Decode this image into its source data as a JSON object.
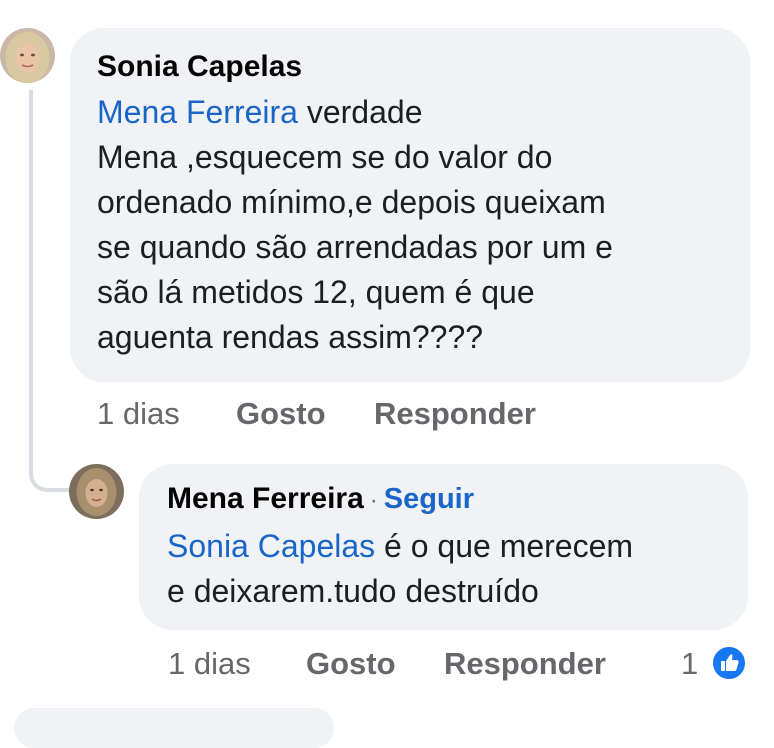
{
  "comment1": {
    "author": "Sonia Capelas",
    "mention": "Mena Ferreira",
    "first_line_rest": " verdade",
    "lines": [
      "Mena ,esquecem se do valor do",
      "ordenado mínimo,e depois queixam",
      "se quando são arrendadas por um e",
      "são lá metidos 12, quem é que",
      "aguenta rendas assim????"
    ],
    "time": "1 dias",
    "like_label": "Gosto",
    "reply_label": "Responder"
  },
  "reply1": {
    "author": "Mena Ferreira",
    "separator": "·",
    "follow_label": "Seguir",
    "mention": "Sonia Capelas",
    "first_line_rest": " é  o que merecem",
    "lines": [
      "e deixarem.tudo destruído"
    ],
    "time": "1 dias",
    "like_label": "Gosto",
    "reply_label": "Responder",
    "reaction_count": "1"
  },
  "colors": {
    "accent": "#1a66c8",
    "bubble": "#f0f2f5",
    "meta": "#65676b",
    "like": "#1877f2"
  },
  "icons": {
    "like_reaction": "thumbs-up-icon"
  }
}
